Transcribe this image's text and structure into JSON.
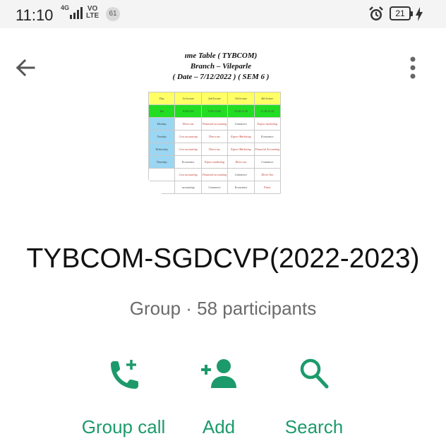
{
  "status_bar": {
    "time": "11:10",
    "network": "4G",
    "volte": "VO\nLTE",
    "notification_count": "61",
    "battery": "21"
  },
  "group_photo": {
    "title_lines": [
      "ıme Table ( TYBCOM)",
      "Branch – Vileparle",
      "( Date – 7/12/2022 ) ( SEM 6 )"
    ],
    "timetable": [
      [
        "Day",
        "1st lecture",
        "2nd lecture",
        "3rd lecture",
        "4th lecture"
      ],
      [
        "Tim",
        "9.00-9.50",
        "9.50-10.40",
        "10.40-11.30",
        "11.30-12.20"
      ],
      [
        "Monday",
        "Direct tax",
        "Financial accounting",
        "Commerce",
        "Export marketing"
      ],
      [
        "Tuesday",
        "Cost accounting",
        "Direct tax",
        "Export Marketing",
        "Economics"
      ],
      [
        "Wednesday",
        "Cost accounting",
        "Direct tax",
        "Export Marketing",
        "Financial Accounting"
      ],
      [
        "Thursday",
        "Economics",
        "Export marketing",
        "Direct tax",
        "Commerce"
      ],
      [
        "",
        "Cost accounting",
        "Financial accounting",
        "Commerce",
        "Direct Tax"
      ],
      [
        "",
        "accounting",
        "Commerce",
        "Economics",
        "Finan"
      ]
    ]
  },
  "group": {
    "name": "TYBCOM-SGDCVP(2022-2023)",
    "meta": "Group · 58 participants"
  },
  "actions": [
    {
      "label": "Group call",
      "icon": "add-call-icon"
    },
    {
      "label": "Add",
      "icon": "add-person-icon"
    },
    {
      "label": "Search",
      "icon": "search-icon"
    }
  ],
  "colors": {
    "accent": "#1d9a6c",
    "meta_text": "#6b6b6b"
  }
}
